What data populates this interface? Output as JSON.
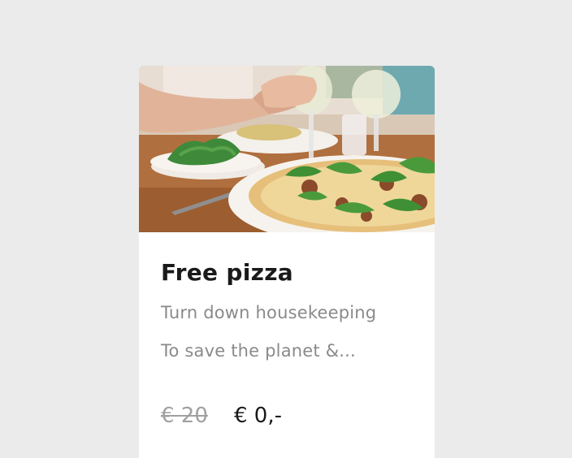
{
  "offer": {
    "title": "Free pizza",
    "description_line1": "Turn down housekeeping",
    "description_line2": "To save the planet &...",
    "price_original": "€ 20",
    "price_current": "€ 0,-",
    "image_subject": "pizza-on-dinner-table"
  },
  "colors": {
    "background": "#ebebeb",
    "card": "#ffffff",
    "title": "#1a1a1a",
    "description": "#8a8a8a",
    "old_price": "#a0a0a0"
  }
}
